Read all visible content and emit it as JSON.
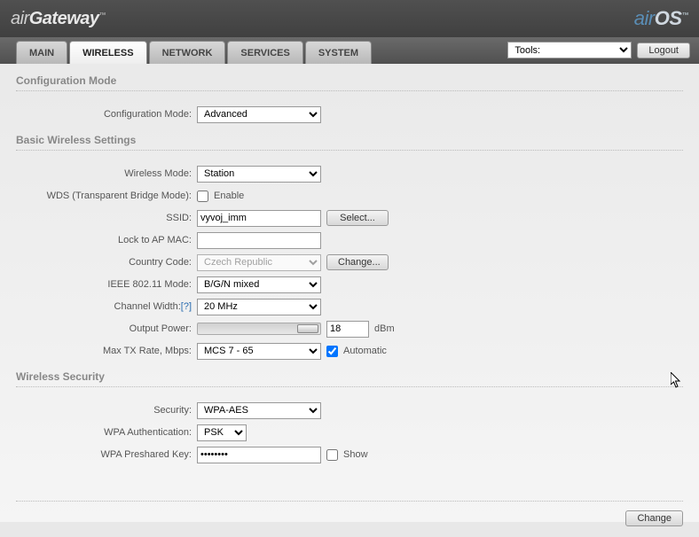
{
  "branding": {
    "left_thin": "air",
    "left_bold": "Gateway",
    "right_air": "air",
    "right_os": "OS",
    "tm": "™"
  },
  "tabs": {
    "main": "MAIN",
    "wireless": "WIRELESS",
    "network": "NETWORK",
    "services": "SERVICES",
    "system": "SYSTEM"
  },
  "toolbar": {
    "tools_label": "Tools:",
    "logout": "Logout"
  },
  "sections": {
    "config_mode": "Configuration Mode",
    "basic_wireless": "Basic Wireless Settings",
    "wireless_security": "Wireless Security"
  },
  "labels": {
    "config_mode": "Configuration Mode:",
    "wireless_mode": "Wireless Mode:",
    "wds": "WDS (Transparent Bridge Mode):",
    "ssid": "SSID:",
    "lock_ap_mac": "Lock to AP MAC:",
    "country": "Country Code:",
    "ieee_mode": "IEEE 802.11 Mode:",
    "channel_width": "Channel Width:",
    "help_q": "[?]",
    "output_power": "Output Power:",
    "max_tx": "Max TX Rate, Mbps:",
    "security": "Security:",
    "wpa_auth": "WPA Authentication:",
    "wpa_psk": "WPA Preshared Key:"
  },
  "values": {
    "config_mode": "Advanced",
    "wireless_mode": "Station",
    "wds_enable": "Enable",
    "ssid": "vyvoj_imm",
    "lock_ap_mac": "",
    "country": "Czech Republic",
    "ieee_mode": "B/G/N mixed",
    "channel_width": "20 MHz",
    "output_power": "18",
    "output_power_unit": "dBm",
    "max_tx": "MCS 7 - 65",
    "automatic": "Automatic",
    "security": "WPA-AES",
    "wpa_auth": "PSK",
    "wpa_psk": "••••••••",
    "show": "Show"
  },
  "buttons": {
    "select": "Select...",
    "change_country": "Change...",
    "change": "Change"
  }
}
